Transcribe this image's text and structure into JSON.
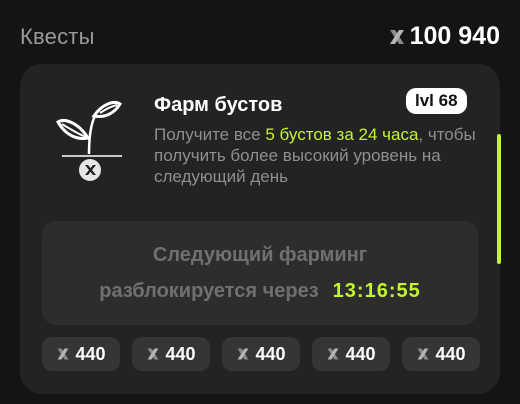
{
  "header": {
    "title": "Квесты",
    "balance": "100 940"
  },
  "quest": {
    "title": "Фарм бустов",
    "level": "lvl 68",
    "desc_prefix": "Получите все ",
    "desc_highlight": "5 бустов за 24 часа",
    "desc_suffix": ", чтобы получить более высокий уровень на следующий день"
  },
  "timer": {
    "line1": "Следующий фарминг",
    "line2": "разблокируется через",
    "value": "13:16:55"
  },
  "rewards": [
    "440",
    "440",
    "440",
    "440",
    "440"
  ],
  "colors": {
    "accent": "#c3f52c",
    "card": "#232323",
    "background": "#141414"
  },
  "icons": {
    "coin": "x-coin-icon",
    "plant": "sprout-icon"
  }
}
